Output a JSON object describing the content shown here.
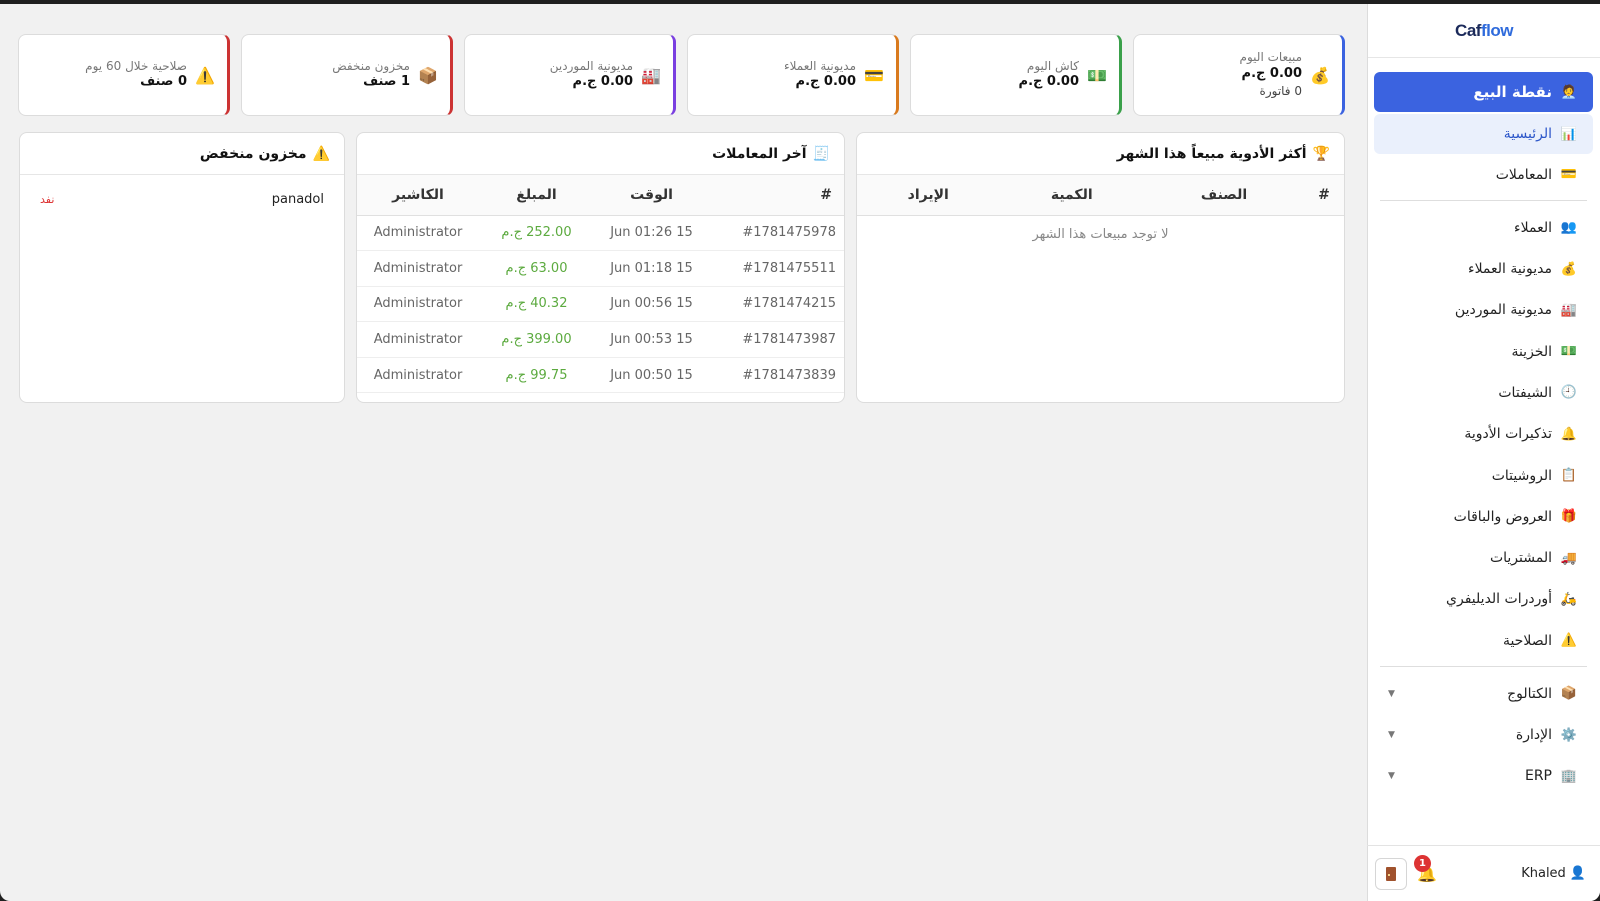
{
  "brand": {
    "prefix": "Caf",
    "suffix": "flow"
  },
  "nav": {
    "pos": {
      "label": "نقطة البيع",
      "icon": "cashier-icon"
    },
    "home": {
      "label": "الرئيسية",
      "icon": "bar-chart-icon"
    },
    "transactions": {
      "label": "المعاملات",
      "icon": "credit-card-icon"
    },
    "customers": {
      "label": "العملاء",
      "icon": "people-icon"
    },
    "customer_debts": {
      "label": "مديونية العملاء",
      "icon": "money-bag-icon"
    },
    "supplier_debts": {
      "label": "مديونية الموردين",
      "icon": "factory-icon"
    },
    "treasury": {
      "label": "الخزينة",
      "icon": "cash-icon"
    },
    "shifts": {
      "label": "الشيفتات",
      "icon": "clock-icon"
    },
    "reminders": {
      "label": "تذكيرات الأدوية",
      "icon": "bell-icon"
    },
    "prescriptions": {
      "label": "الروشيتات",
      "icon": "clipboard-icon"
    },
    "offers": {
      "label": "العروض والباقات",
      "icon": "gift-icon"
    },
    "purchases": {
      "label": "المشتريات",
      "icon": "truck-icon"
    },
    "delivery": {
      "label": "أوردرات الديليفري",
      "icon": "scooter-icon"
    },
    "expiry": {
      "label": "الصلاحية",
      "icon": "warning-icon"
    },
    "catalog": {
      "label": "الكتالوج",
      "icon": "box-icon"
    },
    "admin": {
      "label": "الإدارة",
      "icon": "gear-icon"
    },
    "erp": {
      "label": "ERP",
      "icon": "building-icon"
    }
  },
  "user": {
    "name": "Khaled",
    "notifications": "1"
  },
  "stats": [
    {
      "label": "مبيعات اليوم",
      "value": "0.00 ج.م",
      "sub": "0 فاتورة",
      "icon": "money-bag-icon",
      "color": "#3b63e0"
    },
    {
      "label": "كاش اليوم",
      "value": "0.00 ج.م",
      "icon": "cash-icon",
      "color": "#3aa04a"
    },
    {
      "label": "مديونية العملاء",
      "value": "0.00 ج.م",
      "icon": "credit-card-icon",
      "color": "#d97a1e"
    },
    {
      "label": "مديونية الموردين",
      "value": "0.00 ج.م",
      "icon": "factory-icon",
      "color": "#7a3fe0"
    },
    {
      "label": "مخزون منخفض",
      "value": "1 صنف",
      "icon": "box-icon",
      "color": "#cc3333"
    },
    {
      "label": "صلاحية خلال 60 يوم",
      "value": "0 صنف",
      "icon": "warning-icon",
      "color": "#cc3333"
    }
  ],
  "top_medicines": {
    "title": "أكثر الأدوية مبيعاً هذا الشهر",
    "columns": [
      "#",
      "الصنف",
      "الكمية",
      "الإيراد"
    ],
    "empty": "لا توجد مبيعات هذا الشهر"
  },
  "transactions": {
    "title": "آخر المعاملات",
    "columns": [
      "#",
      "الوقت",
      "المبلغ",
      "الكاشير"
    ],
    "rows": [
      {
        "id": "#1781475978",
        "time": "15 Jun 01:26",
        "amount": "252.00 ج.م",
        "cashier": "Administrator"
      },
      {
        "id": "#1781475511",
        "time": "15 Jun 01:18",
        "amount": "63.00 ج.م",
        "cashier": "Administrator"
      },
      {
        "id": "#1781474215",
        "time": "15 Jun 00:56",
        "amount": "40.32 ج.م",
        "cashier": "Administrator"
      },
      {
        "id": "#1781473987",
        "time": "15 Jun 00:53",
        "amount": "399.00 ج.م",
        "cashier": "Administrator"
      },
      {
        "id": "#1781473839",
        "time": "15 Jun 00:50",
        "amount": "99.75 ج.م",
        "cashier": "Administrator"
      }
    ]
  },
  "low_stock": {
    "title": "مخزون منخفض",
    "items": [
      {
        "name": "panadol",
        "status": "نفد"
      }
    ]
  }
}
